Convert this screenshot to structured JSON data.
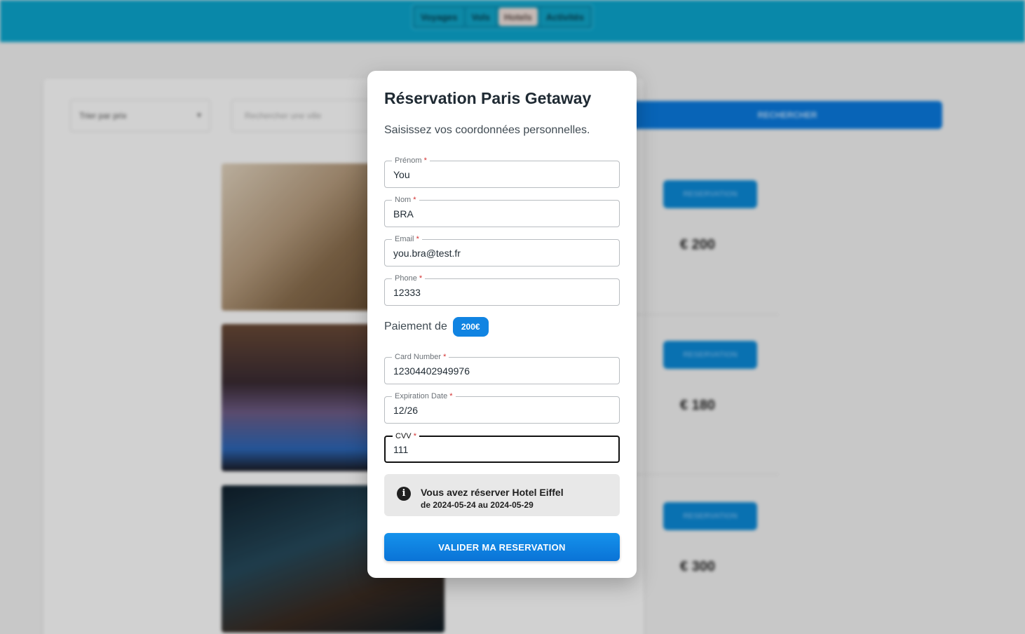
{
  "background": {
    "nav_tabs": [
      "Voyages",
      "Vols",
      "Hotels",
      "Activités"
    ],
    "sort_select": "Trier par prix",
    "search_placeholder": "Rechercher une ville",
    "search_button": "RECHERCHER",
    "book_button": "RESERVATION",
    "prices": [
      "€ 200",
      "€ 180",
      "€ 300"
    ]
  },
  "modal": {
    "title": "Réservation Paris Getaway",
    "subtitle": "Saisissez vos coordonnées personnelles.",
    "fields": {
      "firstname": {
        "label": "Prénom",
        "value": "You"
      },
      "lastname": {
        "label": "Nom",
        "value": "BRA"
      },
      "email": {
        "label": "Email",
        "value": "you.bra@test.fr"
      },
      "phone": {
        "label": "Phone",
        "value": "12333"
      },
      "card": {
        "label": "Card Number",
        "value": "12304402949976"
      },
      "expiry": {
        "label": "Expiration Date",
        "value": "12/26"
      },
      "cvv": {
        "label": "CVV",
        "value": "111"
      }
    },
    "required_mark": "*",
    "payment": {
      "label": "Paiement de",
      "amount": "200€"
    },
    "info": {
      "icon": "info-icon",
      "title": "Vous avez réserver Hotel Eiffel",
      "dates": "de 2024-05-24 au 2024-05-29"
    },
    "submit_label": "VALIDER MA RESERVATION"
  },
  "colors": {
    "accent": "#1184e2",
    "header": "#0ba7cf"
  }
}
